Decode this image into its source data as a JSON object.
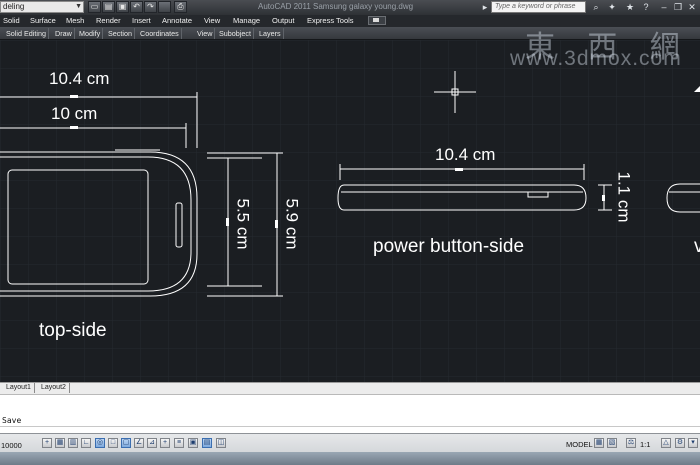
{
  "window": {
    "workspace": "deling",
    "title": "AutoCAD 2011   Samsung galaxy young.dwg",
    "search_placeholder": "Type a keyword or phrase"
  },
  "ribbon_tabs": [
    "Solid",
    "Surface",
    "Mesh",
    "Render",
    "Insert",
    "Annotate",
    "View",
    "Manage",
    "Output",
    "Express Tools"
  ],
  "panels": [
    "Solid Editing",
    "Draw",
    "Modify",
    "Section",
    "Coordinates",
    "View",
    "Subobject",
    "Layers"
  ],
  "drawing": {
    "dim_top_width_outer": "10.4 cm",
    "dim_top_width_inner": "10 cm",
    "dim_height_inner": "5.5 cm",
    "dim_height_outer": "5.9 cm",
    "dim_side_width": "10.4 cm",
    "dim_side_thickness": "1.1 cm",
    "label_top": "top-side",
    "label_power": "power button-side",
    "label_partial": "v"
  },
  "watermark": {
    "chars": "東 西 網",
    "url": "www.3dmox.com"
  },
  "layout_tabs": [
    "Layout1",
    "Layout2"
  ],
  "command": {
    "last": "Save"
  },
  "status": {
    "coordinates": "10000",
    "model": "MODEL",
    "scale": "1:1"
  },
  "colors": {
    "canvas": "#1b1e22",
    "drawing_lines": "#ffffff",
    "grid": "#2b3036"
  }
}
